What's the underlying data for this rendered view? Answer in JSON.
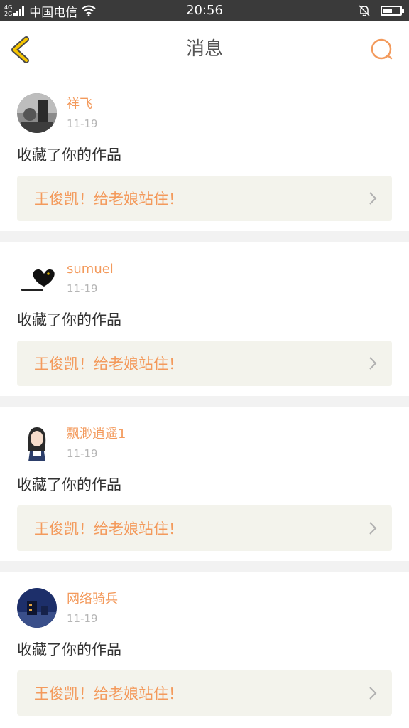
{
  "status_bar": {
    "network_top": "4G",
    "network_bottom": "2G",
    "carrier": "中国电信",
    "time": "20:56",
    "battery_level": 0.55
  },
  "nav": {
    "title": "消息",
    "accent_color": "#f5c400",
    "search_color": "#f39a5c"
  },
  "messages": [
    {
      "user": "祥飞",
      "date": "11-19",
      "action": "收藏了你的作品",
      "work_title": "王俊凯！给老娘站住！"
    },
    {
      "user": "sumuel",
      "date": "11-19",
      "action": "收藏了你的作品",
      "work_title": "王俊凯！给老娘站住！"
    },
    {
      "user": "飘渺逍遥1",
      "date": "11-19",
      "action": "收藏了你的作品",
      "work_title": "王俊凯！给老娘站住！"
    },
    {
      "user": "网络骑兵",
      "date": "11-19",
      "action": "收藏了你的作品",
      "work_title": "王俊凯！给老娘站住！"
    }
  ]
}
